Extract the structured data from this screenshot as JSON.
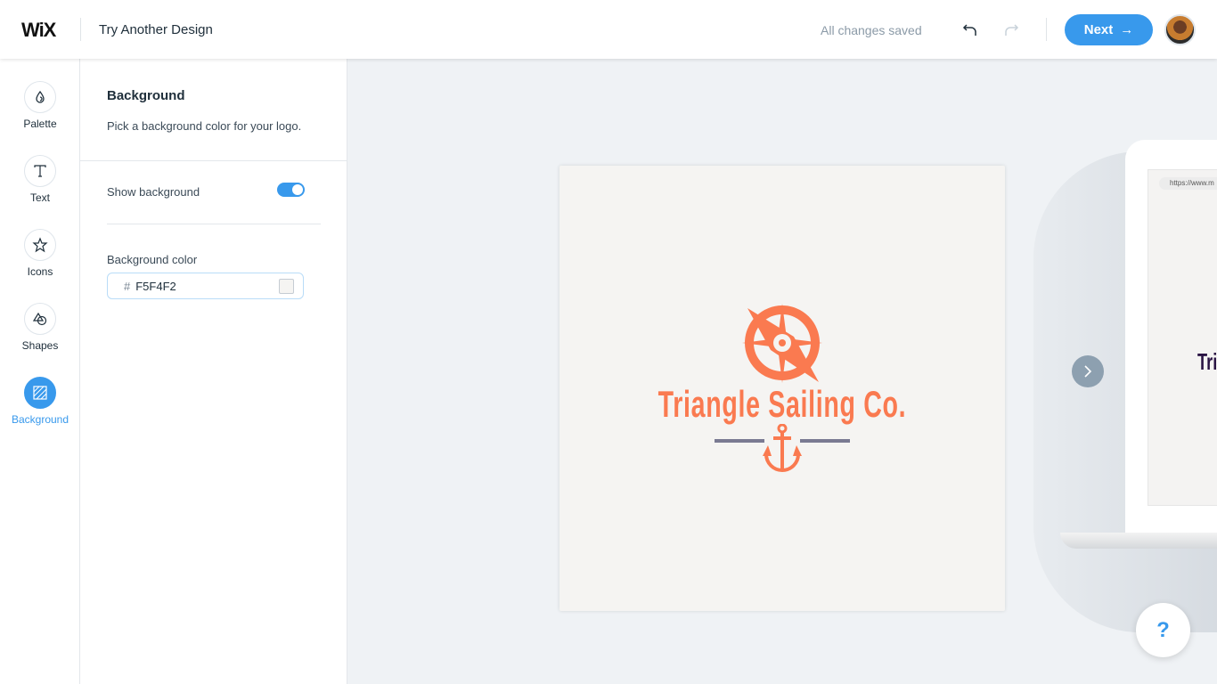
{
  "header": {
    "logo": "WiX",
    "title": "Try Another Design",
    "status": "All changes saved",
    "next_label": "Next"
  },
  "nav": [
    {
      "label": "Palette",
      "icon": "drop-icon"
    },
    {
      "label": "Text",
      "icon": "text-icon"
    },
    {
      "label": "Icons",
      "icon": "star-icon"
    },
    {
      "label": "Shapes",
      "icon": "shapes-icon"
    },
    {
      "label": "Background",
      "icon": "background-icon",
      "active": true
    }
  ],
  "panel": {
    "title": "Background",
    "description": "Pick a background color for your logo.",
    "show_background_label": "Show background",
    "show_background": true,
    "color_label": "Background color",
    "color_value": "F5F4F2"
  },
  "canvas": {
    "background": "#F5F4F2",
    "brand_name": "Triangle Sailing Co.",
    "brand_color": "#FA7A50",
    "line_color": "#7A7A92"
  },
  "preview": {
    "url": "https://www.m",
    "brand_partial": "Tri"
  },
  "help": {
    "label": "?"
  },
  "colors": {
    "accent": "#3899EC"
  }
}
